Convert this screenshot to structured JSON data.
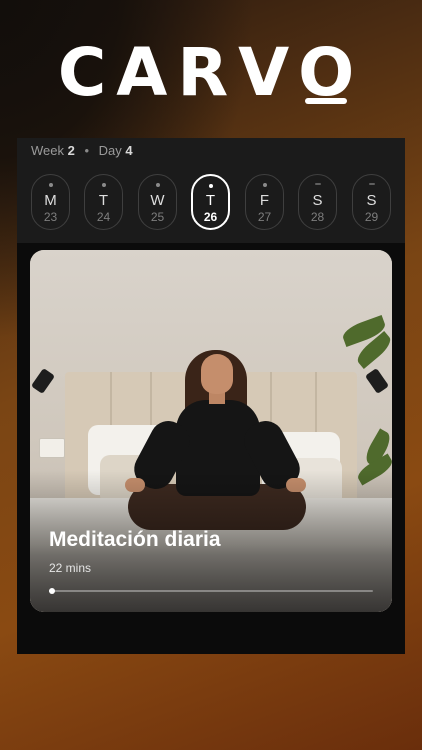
{
  "brand": {
    "logo_text": "CARVO"
  },
  "schedule": {
    "week_label": "Week",
    "week_value": "2",
    "day_label": "Day",
    "day_value": "4",
    "separator": "•",
    "days": [
      {
        "letter": "M",
        "date": "23",
        "marker": "dot",
        "selected": false
      },
      {
        "letter": "T",
        "date": "24",
        "marker": "dot",
        "selected": false
      },
      {
        "letter": "W",
        "date": "25",
        "marker": "dot",
        "selected": false
      },
      {
        "letter": "T",
        "date": "26",
        "marker": "dot",
        "selected": true
      },
      {
        "letter": "F",
        "date": "27",
        "marker": "dot",
        "selected": false
      },
      {
        "letter": "S",
        "date": "28",
        "marker": "dash",
        "selected": false
      },
      {
        "letter": "S",
        "date": "29",
        "marker": "dash",
        "selected": false
      }
    ]
  },
  "session": {
    "title": "Meditación diaria",
    "duration": "22 mins",
    "progress": 0.01
  },
  "colors": {
    "background_top": "#120e0b",
    "background_bottom": "#8a4a12",
    "panel": "#0b0b0b",
    "panel_header": "#1b1b1b",
    "accent": "#ffffff"
  }
}
